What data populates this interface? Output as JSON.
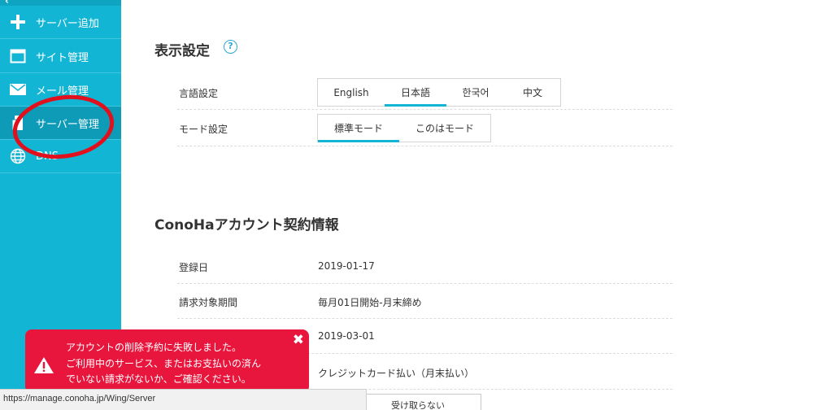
{
  "sidebar": {
    "items": [
      {
        "label": "サーバー追加",
        "icon": "plus-icon"
      },
      {
        "label": "サイト管理",
        "icon": "window-icon"
      },
      {
        "label": "メール管理",
        "icon": "mail-icon"
      },
      {
        "label": "サーバー管理",
        "icon": "server-icon"
      },
      {
        "label": "DNS",
        "icon": "globe-icon"
      }
    ]
  },
  "display_settings": {
    "title": "表示設定",
    "help": "?",
    "language": {
      "label": "言語設定",
      "options": [
        "English",
        "日本語",
        "한국어",
        "中文"
      ],
      "selected": "日本語"
    },
    "mode": {
      "label": "モード設定",
      "options": [
        "標準モード",
        "このはモード"
      ],
      "selected": "標準モード"
    }
  },
  "contract": {
    "title": "ConoHaアカウント契約情報",
    "rows": [
      {
        "label": "登録日",
        "value": "2019-01-17"
      },
      {
        "label": "請求対象期間",
        "value": "毎月01日開始-月末締め"
      },
      {
        "label": "",
        "value": "2019-03-01"
      },
      {
        "label": "",
        "value": "クレジットカード払い（月末払い）"
      }
    ],
    "partial_button": "受け取らない"
  },
  "toast": {
    "lines": [
      "アカウントの削除予約に失敗しました。",
      "ご利用中のサービス、またはお支払いの済ん",
      "でいない請求がないか、ご確認ください。"
    ],
    "close": "✖",
    "color": "#e8153d"
  },
  "status_url": "https://manage.conoha.jp/Wing/Server",
  "colors": {
    "accent": "#13b5d4",
    "annotation": "#e0101c"
  }
}
